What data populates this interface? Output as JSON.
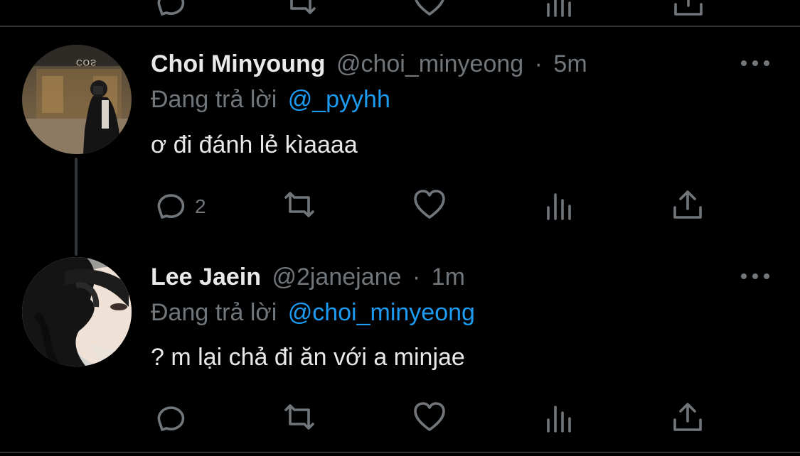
{
  "tweets": [
    {
      "display_name": "Choi Minyoung",
      "handle": "@choi_minyeong",
      "separator": "·",
      "time": "5m",
      "reply_prefix": "Đang trả lời",
      "reply_to": "@_pyyhh",
      "text": "ơ đi đánh lẻ kìaaaa",
      "reply_count": "2"
    },
    {
      "display_name": "Lee Jaein",
      "handle": "@2janejane",
      "separator": "·",
      "time": "1m",
      "reply_prefix": "Đang trả lời",
      "reply_to": "@choi_minyeong",
      "text": "? m lại chả đi ăn với a minjae",
      "reply_count": ""
    }
  ],
  "avatar_1_sign_text": "COS",
  "colors": {
    "background": "#000000",
    "primary_text": "#e7e9ea",
    "muted_text": "#71767b",
    "accent": "#1d9bf0",
    "divider": "#2f3336"
  },
  "action_icons": [
    "reply-icon",
    "retweet-icon",
    "like-icon",
    "analytics-icon",
    "share-icon"
  ]
}
